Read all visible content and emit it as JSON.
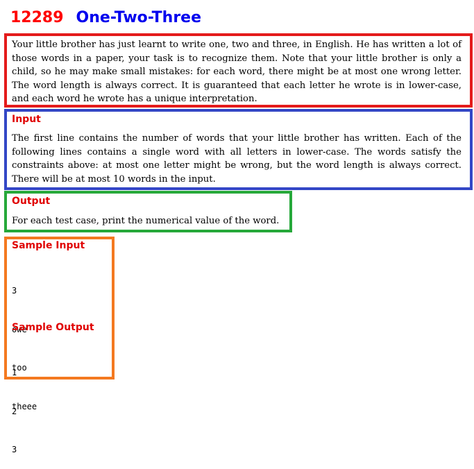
{
  "problem": {
    "number": "12289",
    "title": "One-Two-Three"
  },
  "statement": "Your little brother has just learnt to write one, two and three, in English. He has written a lot of those words in a paper, your task is to recognize them. Note that your little brother is only a child, so he may make small mistakes: for each word, there might be at most one wrong letter. The word length is always correct. It is guaranteed that each letter he wrote is in lower-case, and each word he wrote has a unique interpretation.",
  "input": {
    "heading": "Input",
    "text": "The first line contains the number of words that your little brother has written. Each of the following lines contains a single word with all letters in lower-case. The words satisfy the constraints above: at most one letter might be wrong, but the word length is always correct. There will be at most 10 words in the input."
  },
  "output": {
    "heading": "Output",
    "text": "For each test case, print the numerical value of the word."
  },
  "sample_input": {
    "heading": "Sample Input",
    "lines": [
      "3",
      "owe",
      "too",
      "theee"
    ]
  },
  "sample_output": {
    "heading": "Sample Output",
    "lines": [
      "1",
      "2",
      "3"
    ]
  },
  "colors": {
    "problem_number": "#ff0000",
    "problem_title": "#0000ee",
    "section_heading": "#e00000",
    "statement_box": "#e41b1b",
    "input_box": "#3347c6",
    "output_box": "#26a83a",
    "sample_box": "#f47920"
  }
}
